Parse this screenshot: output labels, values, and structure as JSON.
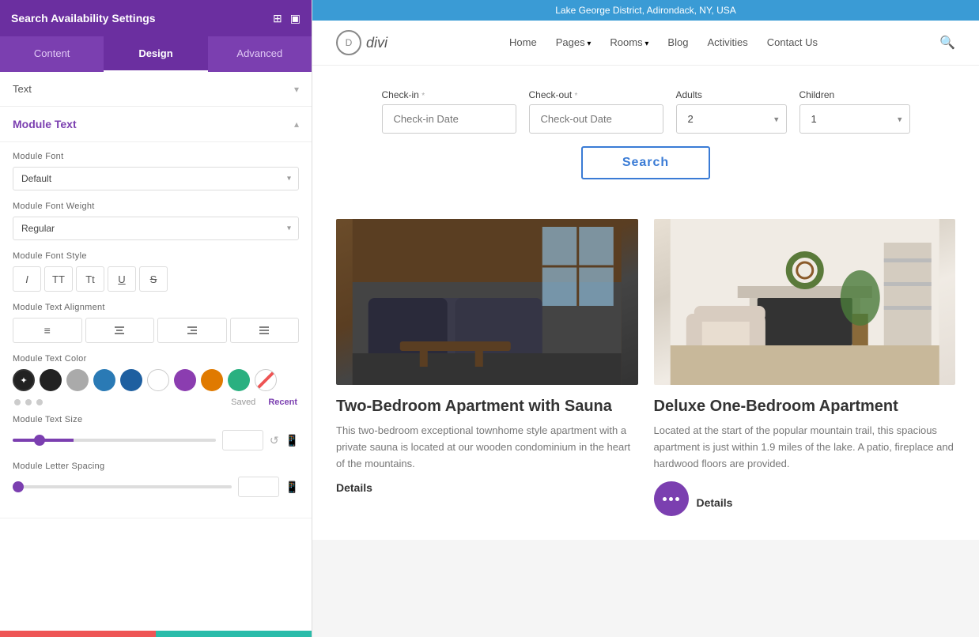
{
  "panel": {
    "title": "Search Availability Settings",
    "tabs": [
      "Content",
      "Design",
      "Advanced"
    ],
    "active_tab": "Design",
    "sections": {
      "text": {
        "label": "Text",
        "collapsed": true
      },
      "module_text": {
        "label": "Module Text",
        "expanded": true
      },
      "module_font": {
        "label": "Module Font",
        "value": "Default"
      },
      "module_font_weight": {
        "label": "Module Font Weight",
        "value": "Regular"
      },
      "module_font_style": {
        "label": "Module Font Style",
        "buttons": [
          "I",
          "TT",
          "Tt",
          "U",
          "S"
        ]
      },
      "module_text_alignment": {
        "label": "Module Text Alignment"
      },
      "module_text_color": {
        "label": "Module Text Color",
        "saved_label": "Saved",
        "recent_label": "Recent",
        "colors": [
          "#222222",
          "#aaaaaa",
          "#2a7ab5",
          "#1e5fa0",
          "#ffffff",
          "#8b3db0",
          "#e07a00",
          "#2ab080",
          "strikethrough"
        ]
      },
      "module_text_size": {
        "label": "Module Text Size",
        "value": "15px"
      },
      "module_letter_spacing": {
        "label": "Module Letter Spacing",
        "value": "0px"
      }
    }
  },
  "topbar": {
    "text": "Lake George District, Adirondack, NY, USA"
  },
  "nav": {
    "logo_text": "divi",
    "logo_initial": "D",
    "links": [
      {
        "label": "Home",
        "has_dropdown": false
      },
      {
        "label": "Pages",
        "has_dropdown": true
      },
      {
        "label": "Rooms",
        "has_dropdown": true
      },
      {
        "label": "Blog",
        "has_dropdown": false
      },
      {
        "label": "Activities",
        "has_dropdown": false
      },
      {
        "label": "Contact Us",
        "has_dropdown": false
      }
    ]
  },
  "search_form": {
    "checkin_label": "Check-in",
    "checkin_required": "*",
    "checkin_placeholder": "Check-in Date",
    "checkout_label": "Check-out",
    "checkout_required": "*",
    "checkout_placeholder": "Check-out Date",
    "adults_label": "Adults",
    "adults_value": "2",
    "children_label": "Children",
    "children_value": "1",
    "button_label": "Search"
  },
  "cards": [
    {
      "title": "Two-Bedroom Apartment with Sauna",
      "description": "This two-bedroom exceptional townhome style apartment with a private sauna is located at our wooden condominium in the heart of the mountains.",
      "details_label": "Details",
      "image_type": "couch"
    },
    {
      "title": "Deluxe One-Bedroom Apartment",
      "description": "Located at the start of the popular mountain trail, this spacious apartment is just within 1.9 miles of the lake. A patio, fireplace and hardwood floors are provided.",
      "details_label": "Details",
      "image_type": "apartment"
    }
  ]
}
